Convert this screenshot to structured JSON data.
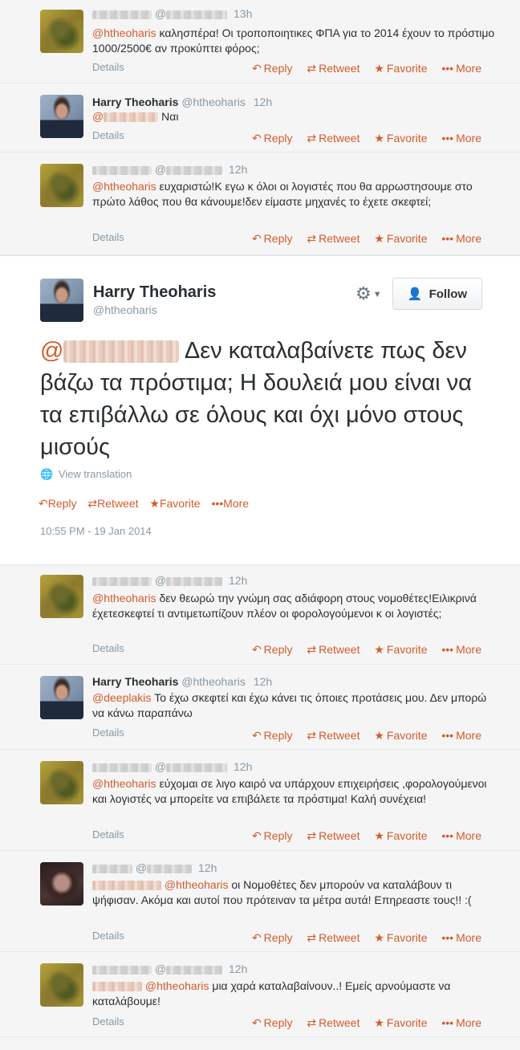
{
  "actions": {
    "reply": "Reply",
    "retweet": "Retweet",
    "favorite": "Favorite",
    "more": "More",
    "details": "Details"
  },
  "tweets_top": [
    {
      "fullname": "",
      "handle_prefix": "@",
      "time": "13h",
      "mention": "@htheoharis",
      "text": "καλησπέρα! Οι τροποποιητικες ΦΠΑ για το 2014 έχουν το πρόστιμο 1000/2500€ αν προκύπτει φόρος;"
    },
    {
      "fullname": "Harry Theoharis",
      "handle": "@htheoharis",
      "time": "12h",
      "mention": "@",
      "text": "Ναι"
    },
    {
      "fullname": "",
      "handle_prefix": "@",
      "time": "12h",
      "mention": "@htheoharis",
      "text": "ευχαριστώ!Κ εγω κ όλοι οι λογιστές  που θα αρρωστησουμε στο πρώτο λάθος που θα κάνουμε!δεν είμαστε μηχανές το έχετε σκεφτεί;"
    }
  ],
  "focus": {
    "fullname": "Harry Theoharis",
    "handle": "@htheoharis",
    "follow_label": "Follow",
    "mention_prefix": "@",
    "text": "Δεν καταλαβαίνετε πως δεν βάζω τα πρόστιμα; Η δουλειά μου είναι να τα επιβάλλω σε όλους και όχι μόνο στους μισούς",
    "view_translation": "View translation",
    "timestamp": "10:55 PM - 19 Jan 2014"
  },
  "tweets_bottom": [
    {
      "fullname": "",
      "handle_prefix": "@",
      "time": "12h",
      "mention": "@htheoharis",
      "text": "δεν θεωρώ την γνώμη σας αδιάφορη στους νομοθέτες!Ειλικρινά έχετεσκεφτεί τι αντιμετωπίζουν πλέον οι φορολογούμενοι κ οι λογιστές;"
    },
    {
      "fullname": "Harry Theoharis",
      "handle": "@htheoharis",
      "time": "12h",
      "mention": "@deeplakis",
      "text": "Το έχω σκεφτεί και έχω κάνει τις όποιες προτάσεις μου. Δεν μπορώ να κάνω παραπάνω"
    },
    {
      "fullname": "",
      "handle_prefix": "@",
      "time": "12h",
      "mention": "@htheoharis",
      "text": "εύχομαι σε λιγο καιρό να υπάρχουν επιχειρήσεις ,φορολογούμενοι και λογιστές να μπορείτε να επιβάλετε τα πρόστιμα! Καλή συνέχεια!"
    },
    {
      "fullname": "",
      "handle_prefix": "@",
      "time": "12h",
      "mention": "@htheoharis",
      "text": "οι Νομοθέτες δεν μπορούν να καταλάβουν τι ψήφισαν.  Ακόμα και αυτοί που πρότειναν τα μέτρα αυτά! Επηρεαστε τους!! :("
    },
    {
      "fullname": "",
      "handle_prefix": "@",
      "time": "12h",
      "mention": "@htheoharis",
      "text": "μια χαρά καταλαβαίνουν..! Εμείς αρνούμαστε να καταλάβουμε!"
    }
  ]
}
